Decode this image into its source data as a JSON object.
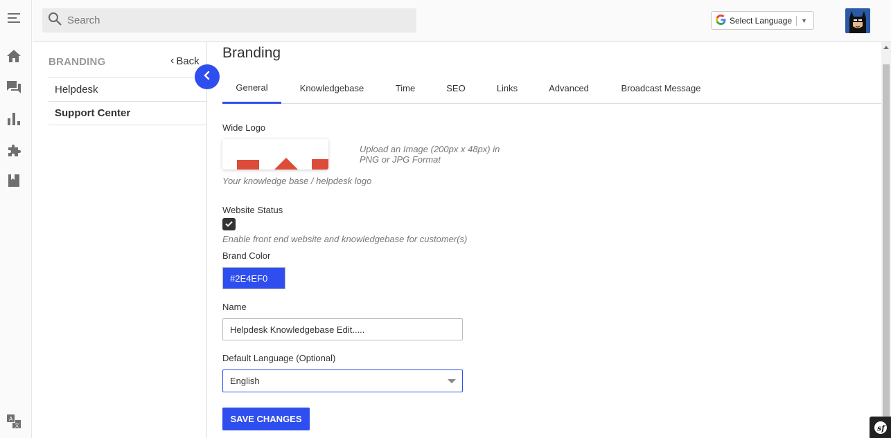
{
  "search": {
    "placeholder": "Search"
  },
  "language_selector": {
    "g_letter": "G",
    "label": "Select Language",
    "arrow": "▼"
  },
  "rail": {
    "icons": [
      "menu-icon",
      "home-icon",
      "tickets-icon",
      "reports-icon",
      "apps-icon",
      "knowledgebase-icon",
      "translate-icon"
    ]
  },
  "sidebar": {
    "title": "BRANDING",
    "back_label": "Back",
    "back_chevron": "‹",
    "items": [
      {
        "label": "Helpdesk",
        "active": false
      },
      {
        "label": "Support Center",
        "active": true
      }
    ]
  },
  "main": {
    "heading": "Branding",
    "tabs": [
      {
        "label": "General",
        "active": true
      },
      {
        "label": "Knowledgebase",
        "active": false
      },
      {
        "label": "Time",
        "active": false
      },
      {
        "label": "SEO",
        "active": false
      },
      {
        "label": "Links",
        "active": false
      },
      {
        "label": "Advanced",
        "active": false
      },
      {
        "label": "Broadcast Message",
        "active": false
      }
    ],
    "wide_logo": {
      "label": "Wide Logo",
      "upload_hint": "Upload an Image (200px x 48px) in PNG or JPG Format",
      "help": "Your knowledge base / helpdesk logo"
    },
    "website_status": {
      "label": "Website Status",
      "checked": true,
      "help": "Enable front end website and knowledgebase for customer(s)"
    },
    "brand_color": {
      "label": "Brand Color",
      "value": "#2E4EF0"
    },
    "name": {
      "label": "Name",
      "value": "Helpdesk Knowledgebase Edit....."
    },
    "default_language": {
      "label": "Default Language (Optional)",
      "value": "English"
    },
    "save_label": "SAVE CHANGES"
  },
  "colors": {
    "accent": "#2E4EF0",
    "logo_red": "#dd4b39"
  }
}
